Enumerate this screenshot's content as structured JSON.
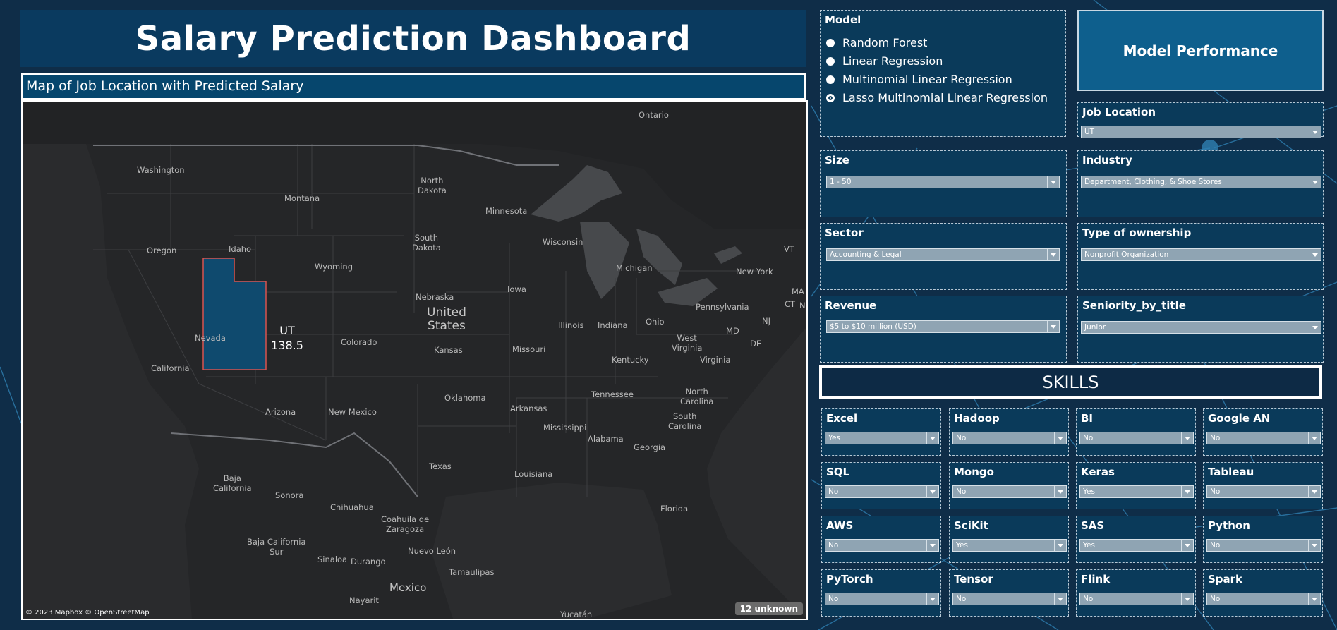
{
  "dashboard": {
    "title": "Salary Prediction Dashboard",
    "map_caption": "Map of Job Location with Predicted Salary"
  },
  "map": {
    "highlight_state": "UT",
    "highlight_value": "138.5",
    "credit": "© 2023 Mapbox © OpenStreetMap",
    "unknown_badge": "12 unknown",
    "labels": {
      "ontario": "Ontario",
      "washington": "Washington",
      "montana": "Montana",
      "north_dakota": "North\nDakota",
      "minnesota": "Minnesota",
      "oregon": "Oregon",
      "idaho": "Idaho",
      "south_dakota": "South\nDakota",
      "wisconsin": "Wisconsin",
      "michigan": "Michigan",
      "wyoming": "Wyoming",
      "iowa": "Iowa",
      "nebraska": "Nebraska",
      "united_states": "United\nStates",
      "nevada": "Nevada",
      "colorado": "Colorado",
      "kansas": "Kansas",
      "illinois": "Illinois",
      "indiana": "Indiana",
      "ohio": "Ohio",
      "pennsylvania": "Pennsylvania",
      "new_york": "New York",
      "vt": "VT",
      "ma": "MA",
      "ct": "CT",
      "nh": "NH",
      "nj": "NJ",
      "md": "MD",
      "de": "DE",
      "missouri": "Missouri",
      "kentucky": "Kentucky",
      "west_virginia": "West\nVirginia",
      "virginia": "Virginia",
      "california": "California",
      "oklahoma": "Oklahoma",
      "tennessee": "Tennessee",
      "north_carolina": "North\nCarolina",
      "arizona": "Arizona",
      "new_mexico": "New Mexico",
      "arkansas": "Arkansas",
      "south_carolina": "South\nCarolina",
      "mississippi": "Mississippi",
      "alabama": "Alabama",
      "georgia": "Georgia",
      "texas": "Texas",
      "louisiana": "Louisiana",
      "baja_california": "Baja\nCalifornia",
      "sonora": "Sonora",
      "chihuahua": "Chihuahua",
      "florida": "Florida",
      "coahuila": "Coahuila de\nZaragoza",
      "baja_california_sur": "Baja California\nSur",
      "sinaloa": "Sinaloa",
      "durango": "Durango",
      "nuevo_leon": "Nuevo León",
      "tamaulipas": "Tamaulipas",
      "mexico": "Mexico",
      "nayarit": "Nayarit",
      "yucatan": "Yucatán"
    }
  },
  "model": {
    "title": "Model",
    "options": [
      "Random Forest",
      "Linear Regression",
      "Multinomial Linear Regression",
      "Lasso Multinomial Linear Regression"
    ],
    "selected": "Lasso Multinomial Linear Regression"
  },
  "model_performance": "Model Performance",
  "filters": {
    "job_location": {
      "label": "Job Location",
      "value": "UT"
    },
    "size": {
      "label": "Size",
      "value": "1 - 50"
    },
    "industry": {
      "label": "Industry",
      "value": "Department, Clothing, & Shoe Stores"
    },
    "sector": {
      "label": "Sector",
      "value": "Accounting & Legal"
    },
    "ownership": {
      "label": "Type of ownership",
      "value": "Nonprofit Organization"
    },
    "revenue": {
      "label": "Revenue",
      "value": "$5 to $10 million (USD)"
    },
    "seniority": {
      "label": "Seniority_by_title",
      "value": "Junior"
    }
  },
  "skills": {
    "title": "SKILLS",
    "items": [
      {
        "label": "Excel",
        "value": "Yes"
      },
      {
        "label": "Hadoop",
        "value": "No"
      },
      {
        "label": "BI",
        "value": "No"
      },
      {
        "label": "Google AN",
        "value": "No"
      },
      {
        "label": "SQL",
        "value": "No"
      },
      {
        "label": "Mongo",
        "value": "No"
      },
      {
        "label": "Keras",
        "value": "Yes"
      },
      {
        "label": "Tableau",
        "value": "No"
      },
      {
        "label": "AWS",
        "value": "No"
      },
      {
        "label": "SciKit",
        "value": "Yes"
      },
      {
        "label": "SAS",
        "value": "Yes"
      },
      {
        "label": "Python",
        "value": "No"
      },
      {
        "label": "PyTorch",
        "value": "No"
      },
      {
        "label": "Tensor",
        "value": "No"
      },
      {
        "label": "Flink",
        "value": "No"
      },
      {
        "label": "Spark",
        "value": "No"
      }
    ]
  },
  "colors": {
    "title_bg": "#0a3a5f",
    "panel_bg": "#0a3a5a",
    "highlight_fill": "#0f4a6e",
    "highlight_border": "#d9534f",
    "model_perf_bg": "#0e5f8d"
  }
}
